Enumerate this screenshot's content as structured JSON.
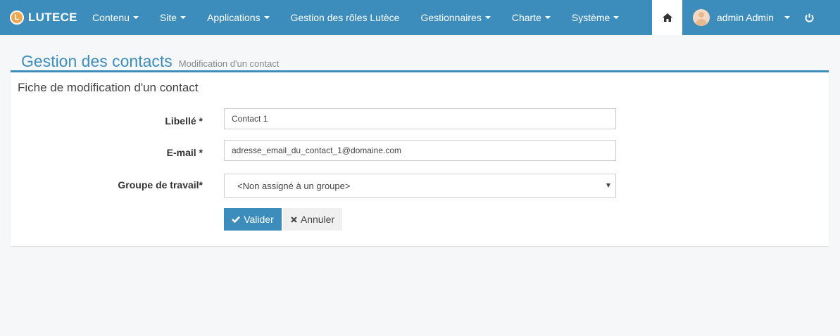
{
  "brand": {
    "logo_letter": "L",
    "name": "LUTECE"
  },
  "nav": {
    "items": [
      {
        "label": "Contenu",
        "dropdown": true
      },
      {
        "label": "Site",
        "dropdown": true
      },
      {
        "label": "Applications",
        "dropdown": true
      },
      {
        "label": "Gestion des rôles Lutèce",
        "dropdown": false
      },
      {
        "label": "Gestionnaires",
        "dropdown": true
      },
      {
        "label": "Charte",
        "dropdown": true
      },
      {
        "label": "Système",
        "dropdown": true
      }
    ],
    "home_icon": "home-icon",
    "user_name": "admin Admin",
    "power_icon": "power-icon"
  },
  "page": {
    "title": "Gestion des contacts",
    "subtitle": "Modification d'un contact"
  },
  "form": {
    "title": "Fiche de modification d'un contact",
    "label_fields": {
      "libelle": "Libellé *",
      "email": "E-mail *",
      "group": "Groupe de travail*"
    },
    "libelle_value": "Contact 1",
    "email_value": "adresse_email_du_contact_1@domaine.com",
    "group_selected": "<Non assigné à un groupe>",
    "submit_label": "Valider",
    "cancel_label": "Annuler"
  },
  "colors": {
    "primary": "#3c8dbc",
    "background": "#f6f7f9"
  }
}
